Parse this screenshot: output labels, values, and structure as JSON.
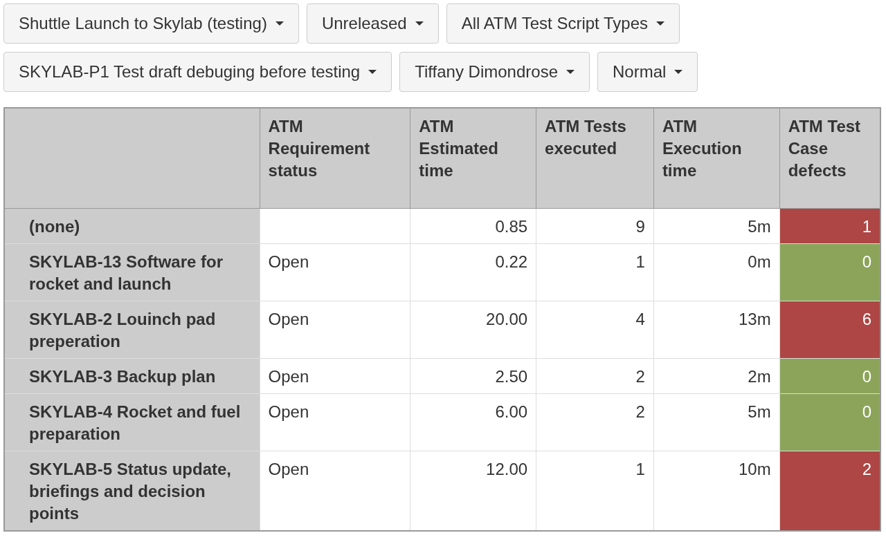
{
  "filters": [
    {
      "label": "Shuttle Launch to Skylab (testing)"
    },
    {
      "label": "Unreleased"
    },
    {
      "label": "All ATM Test Script Types"
    },
    {
      "label": "SKYLAB-P1 Test draft debuging before testing"
    },
    {
      "label": "Tiffany Dimondrose"
    },
    {
      "label": "Normal"
    }
  ],
  "table": {
    "columns": [
      "",
      "ATM Requirement status",
      "ATM Estimated time",
      "ATM Tests executed",
      "ATM Execution time",
      "ATM Test Case defects"
    ],
    "rows": [
      {
        "name": "(none)",
        "status": "",
        "estimated": "0.85",
        "executed": "9",
        "execution_time": "5m",
        "defects": "1",
        "color": "#ad4644"
      },
      {
        "name": "SKYLAB-13 Software for rocket and launch",
        "status": "Open",
        "estimated": "0.22",
        "executed": "1",
        "execution_time": "0m",
        "defects": "0",
        "color": "#8ca45a"
      },
      {
        "name": "SKYLAB-2 Louinch pad preperation",
        "status": "Open",
        "estimated": "20.00",
        "executed": "4",
        "execution_time": "13m",
        "defects": "6",
        "color": "#ad4644"
      },
      {
        "name": "SKYLAB-3 Backup plan",
        "status": "Open",
        "estimated": "2.50",
        "executed": "2",
        "execution_time": "2m",
        "defects": "0",
        "color": "#8ca45a"
      },
      {
        "name": "SKYLAB-4 Rocket and fuel preparation",
        "status": "Open",
        "estimated": "6.00",
        "executed": "2",
        "execution_time": "5m",
        "defects": "0",
        "color": "#8ca45a"
      },
      {
        "name": "SKYLAB-5 Status update, briefings and decision points",
        "status": "Open",
        "estimated": "12.00",
        "executed": "1",
        "execution_time": "10m",
        "defects": "2",
        "color": "#ad4644"
      }
    ]
  }
}
